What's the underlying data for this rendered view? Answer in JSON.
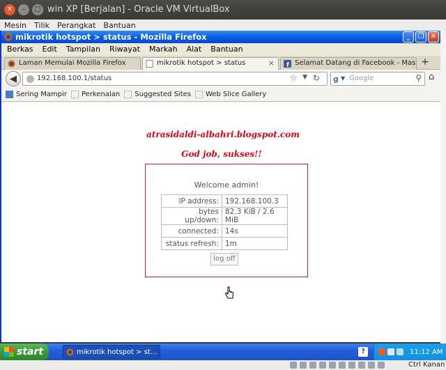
{
  "host": {
    "title": "win XP [Berjalan] - Oracle VM VirtualBox",
    "menu": [
      "Mesin",
      "Tilik",
      "Perangkat",
      "Bantuan"
    ]
  },
  "firefox": {
    "window_title": "mikrotik hotspot > status - Mozilla Firefox",
    "menu": [
      "Berkas",
      "Edit",
      "Tampilan",
      "Riwayat",
      "Markah",
      "Alat",
      "Bantuan"
    ],
    "tabs": [
      {
        "label": "Laman Memulai Mozilla Firefox",
        "icon": "firefox-icon"
      },
      {
        "label": "mikrotik hotspot > status",
        "icon": "page-icon"
      },
      {
        "label": "Selamat Datang di Facebook - Masuk, Da...",
        "icon": "facebook-icon"
      }
    ],
    "url": "192.168.100.1/status",
    "search_placeholder": "Google",
    "bookmarks": [
      "Sering Mampir",
      "Perkenalan",
      "Suggested Sites",
      "Web Slice Gallery"
    ]
  },
  "page": {
    "brand": "atrasidaldi-albahri.blogspot.com",
    "success_message": "God job, sukses!!",
    "welcome": "Welcome admin!",
    "rows": [
      {
        "key": "IP address:",
        "value": "192.168.100.3"
      },
      {
        "key": "bytes up/down:",
        "value": "82.3 KiB / 2.6 MiB"
      },
      {
        "key": "connected:",
        "value": "14s"
      },
      {
        "key": "status refresh:",
        "value": "1m"
      }
    ],
    "logoff_label": "log off"
  },
  "taskbar": {
    "start_label": "start",
    "task": "mikrotik hotspot > st...",
    "clock": "11:12 AM"
  },
  "vbox_status": {
    "host_key": "Ctrl Kanan"
  },
  "colors": {
    "accent_red": "#e00010",
    "xp_blue": "#0a5ee0",
    "start_green": "#3a9a3a"
  }
}
